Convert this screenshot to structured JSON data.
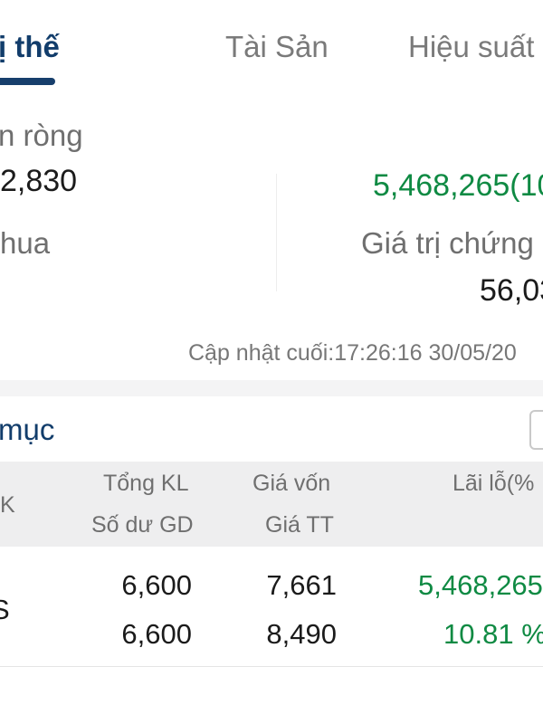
{
  "tabs": [
    {
      "label": "Vị thế",
      "visible_text": "ị thế",
      "active": true
    },
    {
      "label": "Tài Sản",
      "active": false
    },
    {
      "label": "Hiệu suất",
      "active": false
    }
  ],
  "summary": {
    "net_label": "n ròng",
    "net_value": "2,830",
    "profit_value": "5,468,265(10",
    "buy_label": "hua",
    "securities_value_label": "Giá trị chứng",
    "securities_value": "56,03"
  },
  "last_updated": "Cập nhật cuối:17:26:16 30/05/20",
  "portfolio": {
    "title": "mục",
    "headers": {
      "col0": "K",
      "total_qty": "Tổng KL",
      "tradable_balance": "Số dư GD",
      "cost_price": "Giá vốn",
      "market_price": "Giá TT",
      "pnl": "Lãi lỗ(%"
    },
    "rows": [
      {
        "symbol_fragment": "S",
        "total_qty": "6,600",
        "tradable_balance": "6,600",
        "cost_price": "7,661",
        "market_price": "8,490",
        "pnl_value": "5,468,265",
        "pnl_percent": "10.81 %"
      }
    ]
  },
  "colors": {
    "accent": "#123d6b",
    "profit": "#0f8a43",
    "header_bg": "#eeeeef"
  }
}
